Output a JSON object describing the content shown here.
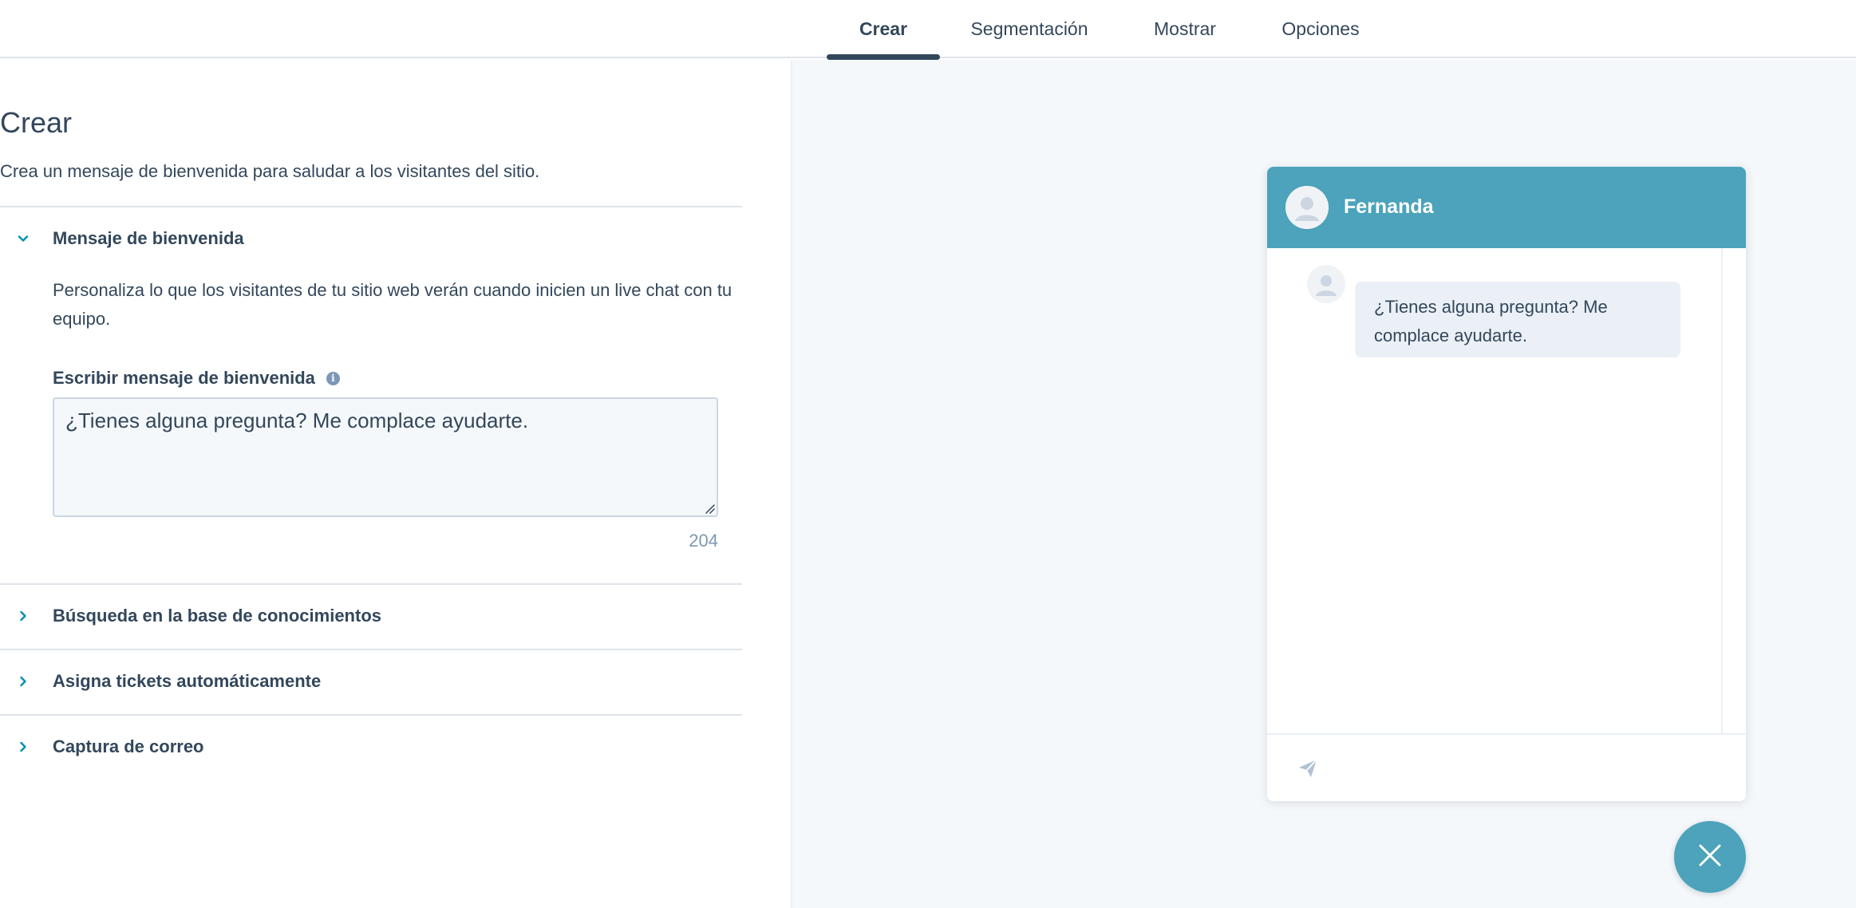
{
  "tabs": [
    {
      "label": "Crear",
      "active": true
    },
    {
      "label": "Segmentación",
      "active": false
    },
    {
      "label": "Mostrar",
      "active": false
    },
    {
      "label": "Opciones",
      "active": false
    }
  ],
  "main": {
    "title": "Crear",
    "description": "Crea un mensaje de bienvenida para saludar a los visitantes del sitio.",
    "sections": [
      {
        "title": "Mensaje de bienvenida",
        "expanded": true,
        "body": "Personaliza lo que los visitantes de tu sitio web verán cuando inicien un live chat con tu equipo.",
        "field_label": "Escribir mensaje de bienvenida",
        "field_value": "¿Tienes alguna pregunta? Me complace ayudarte.",
        "char_count": "204"
      },
      {
        "title": "Búsqueda en la base de conocimientos",
        "expanded": false
      },
      {
        "title": "Asigna tickets automáticamente",
        "expanded": false
      },
      {
        "title": "Captura de correo",
        "expanded": false
      }
    ]
  },
  "preview": {
    "agent_name": "Fernanda",
    "message": "¿Tienes alguna pregunta? Me complace ayudarte.",
    "header_color": "#4ca3bb"
  },
  "icons": {
    "expanded": "chevron-down-icon",
    "collapsed": "chevron-right-icon",
    "info": "info-icon",
    "send": "send-icon",
    "close": "close-icon",
    "avatar": "avatar-icon"
  },
  "colors": {
    "text": "#33475b",
    "accent": "#0091ae",
    "muted": "#7c98b6",
    "divider": "#dfe3eb",
    "preview_bg": "#f5f8fa"
  }
}
